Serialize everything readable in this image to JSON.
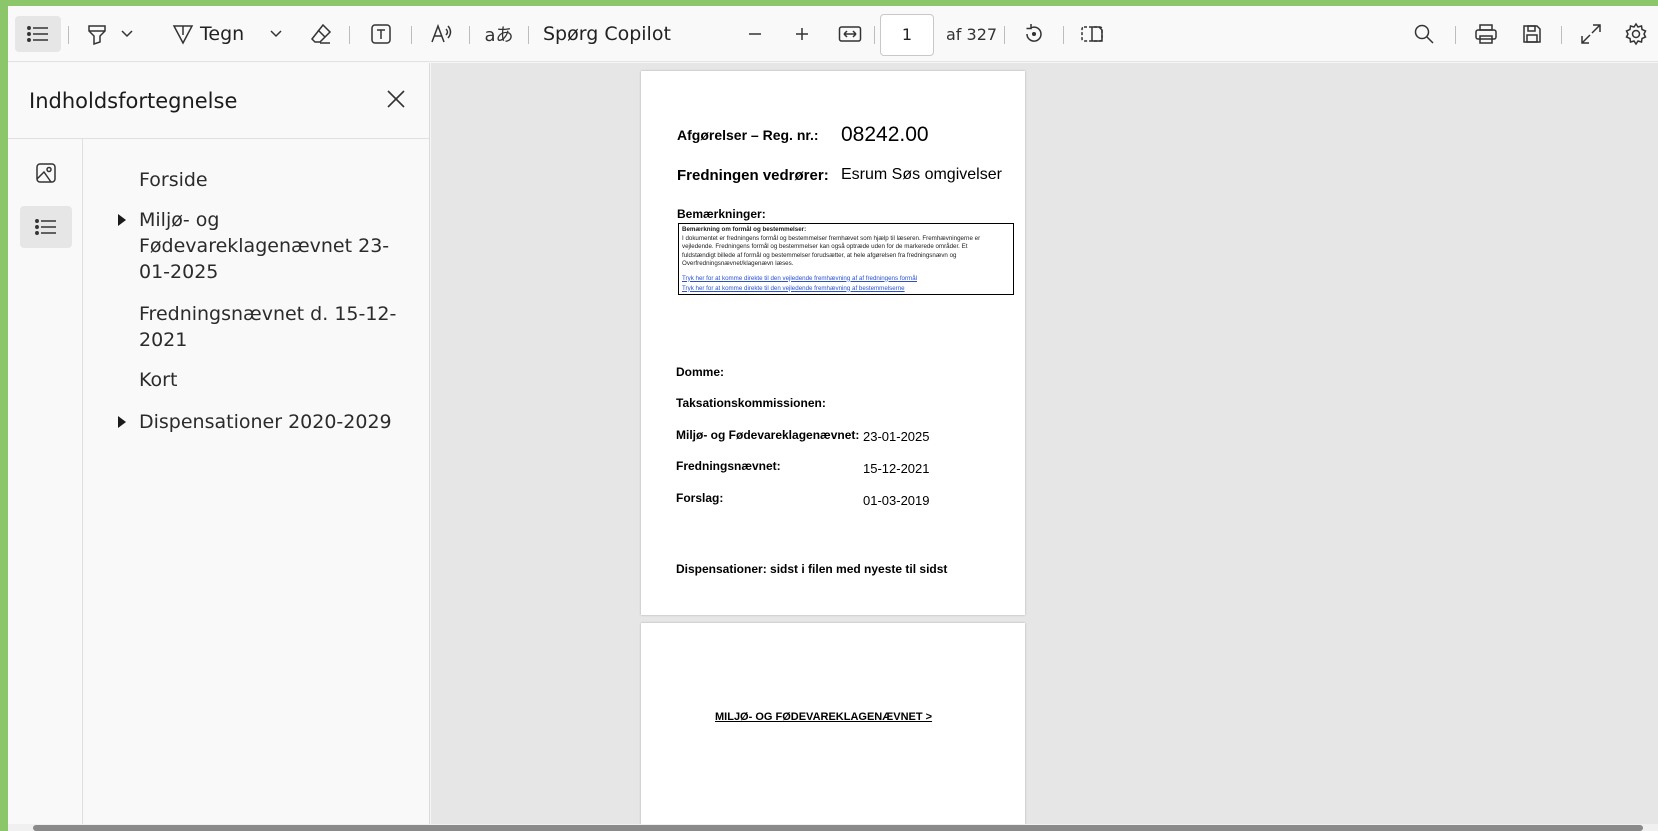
{
  "toolbar": {
    "draw_label": "Tegn",
    "copilot_label": "Spørg Copilot",
    "page_current": "1",
    "page_total": "af 327",
    "translate_glyph": "aあ"
  },
  "panel": {
    "title": "Indholdsfortegnelse",
    "toc": [
      {
        "label": "Forside",
        "expandable": false
      },
      {
        "label": "Miljø- og Fødevareklagenævnet 23-01-2025",
        "expandable": true
      },
      {
        "label": "Fredningsnævnet d. 15-12-2021",
        "expandable": false
      },
      {
        "label": "Kort",
        "expandable": false
      },
      {
        "label": "Dispensationer 2020-2029",
        "expandable": true
      }
    ]
  },
  "document": {
    "page1": {
      "reg_label": "Afgørelser – Reg. nr.:",
      "reg_value": "08242.00",
      "fredning_label": "Fredningen vedrører:",
      "fredning_value": "Esrum Søs omgivelser",
      "remarks_label": "Bemærkninger:",
      "note_title": "Bemærkning om formål og bestemmelser:",
      "note_lines": [
        "I dokumentet er fredningens formål og bestemmelser fremhævet som hjælp til læseren. Fremhævningerne er",
        "vejledende. Fredningens formål og bestemmelser kan også optræde uden for de markerede områder. Et",
        "fuldstændigt billede af formål og bestemmelser forudsætter, at hele afgørelsen fra fredningsnævn og",
        "Overfredningsnævnet/klagenævn læses."
      ],
      "note_link_1": "Tryk her for at komme direkte til den vejledende fremhævning af af fredningens formål",
      "note_link_2": "Tryk her for at komme direkte til den vejledende fremhævning af bestemmelserne",
      "domme_label": "Domme:",
      "taksation_label": "Taksationskommissionen:",
      "mfkn_label": "Miljø- og Fødevareklagenævnet:",
      "mfkn_value": "23-01-2025",
      "fredningsnaevnet_label": "Fredningsnævnet:",
      "fredningsnaevnet_value": "15-12-2021",
      "forslag_label": "Forslag:",
      "forslag_value": "01-03-2019",
      "dispensationer": "Dispensationer: sidst i filen med nyeste til sidst"
    },
    "page2": {
      "heading": "MILJØ- OG FØDEVAREKLAGENÆVNET >"
    }
  }
}
